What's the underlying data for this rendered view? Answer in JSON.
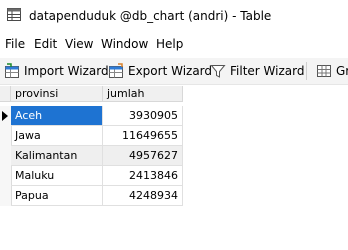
{
  "window": {
    "title": "datapenduduk @db_chart (andri) - Table"
  },
  "menu": [
    "File",
    "Edit",
    "View",
    "Window",
    "Help"
  ],
  "toolbar": {
    "import_label": "Import Wizard",
    "export_label": "Export Wizard",
    "filter_label": "Filter Wizard",
    "grid_label": "Gr"
  },
  "table": {
    "columns": [
      "provinsi",
      "jumlah"
    ],
    "rows": [
      {
        "provinsi": "Aceh",
        "jumlah": "3930905"
      },
      {
        "provinsi": "Jawa",
        "jumlah": "11649655"
      },
      {
        "provinsi": "Kalimantan",
        "jumlah": "4957627"
      },
      {
        "provinsi": "Maluku",
        "jumlah": "2413846"
      },
      {
        "provinsi": "Papua",
        "jumlah": "4248934"
      }
    ]
  },
  "colors": {
    "selection": "#1e73d2",
    "alt_row": "#efefef"
  }
}
